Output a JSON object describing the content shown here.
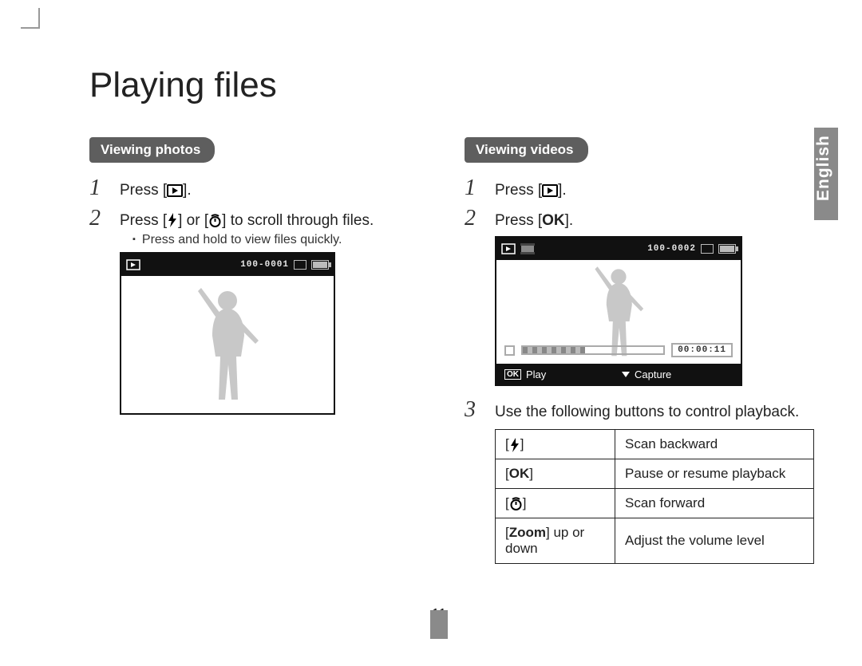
{
  "page_title": "Playing files",
  "side_tab": "English",
  "page_number": "11",
  "left": {
    "section_title": "Viewing photos",
    "step1": "Press [",
    "step1_tail": "].",
    "step2_pre": "Press [",
    "step2_mid": "] or [",
    "step2_post": "] to scroll through files.",
    "subnote": "Press and hold to view files quickly.",
    "lcd_file": "100-0001"
  },
  "right": {
    "section_title": "Viewing videos",
    "step1": "Press [",
    "step1_tail": "].",
    "step2_pre": "Press [",
    "step2_ok": "OK",
    "step2_tail": "].",
    "lcd_file": "100-0002",
    "lcd_time": "00:00:11",
    "lcd_foot_play": "Play",
    "lcd_foot_capture": "Capture",
    "step3": "Use the following buttons to control playback."
  },
  "controls": {
    "r1_desc": "Scan backward",
    "r2_key": "OK",
    "r2_desc": "Pause or resume playback",
    "r3_desc": "Scan forward",
    "r4_key_bold": "Zoom",
    "r4_key_rest": " up or down",
    "r4_desc": "Adjust the volume level"
  }
}
